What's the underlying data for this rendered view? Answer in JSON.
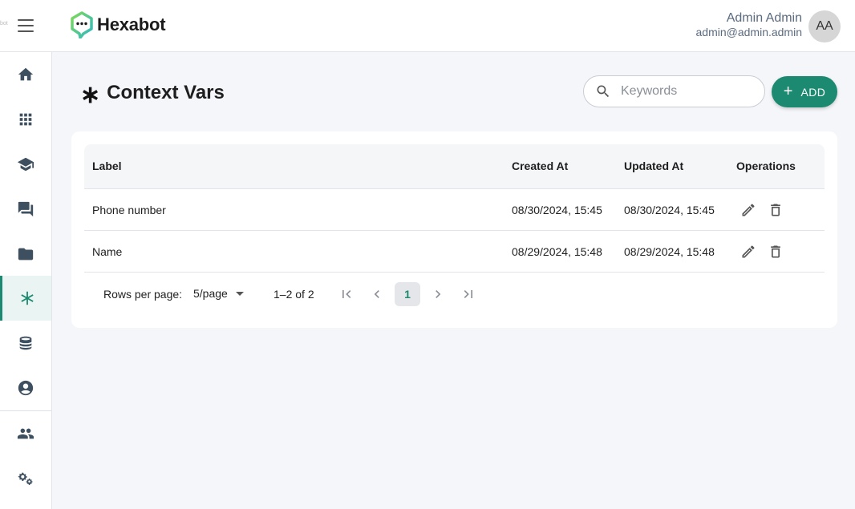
{
  "header": {
    "brand": "Hexabot",
    "user_name": "Admin Admin",
    "user_email": "admin@admin.admin",
    "avatar_initials": "AA"
  },
  "sidebar": {
    "items": [
      {
        "icon": "home-icon"
      },
      {
        "icon": "apps-grid-icon"
      },
      {
        "icon": "graduation-cap-icon"
      },
      {
        "icon": "chat-bubbles-icon"
      },
      {
        "icon": "folder-icon"
      },
      {
        "icon": "asterisk-icon",
        "active": true
      },
      {
        "icon": "database-icon"
      },
      {
        "icon": "account-circle-icon"
      },
      {
        "icon": "users-group-icon"
      },
      {
        "icon": "settings-gears-icon"
      }
    ],
    "active_color": "#1c8a70"
  },
  "page": {
    "title": "Context Vars",
    "search_placeholder": "Keywords",
    "add_label": "ADD"
  },
  "table": {
    "columns": [
      "Label",
      "Created At",
      "Updated At",
      "Operations"
    ],
    "rows": [
      {
        "label": "Phone number",
        "created_at": "08/30/2024, 15:45",
        "updated_at": "08/30/2024, 15:45"
      },
      {
        "label": "Name",
        "created_at": "08/29/2024, 15:48",
        "updated_at": "08/29/2024, 15:48"
      }
    ]
  },
  "pagination": {
    "rows_per_page_label": "Rows per page:",
    "rows_per_page_value": "5/page",
    "range_text": "1–2 of 2",
    "current_page": "1"
  },
  "colors": {
    "accent": "#1c8a70",
    "background": "#f5f6fa"
  }
}
